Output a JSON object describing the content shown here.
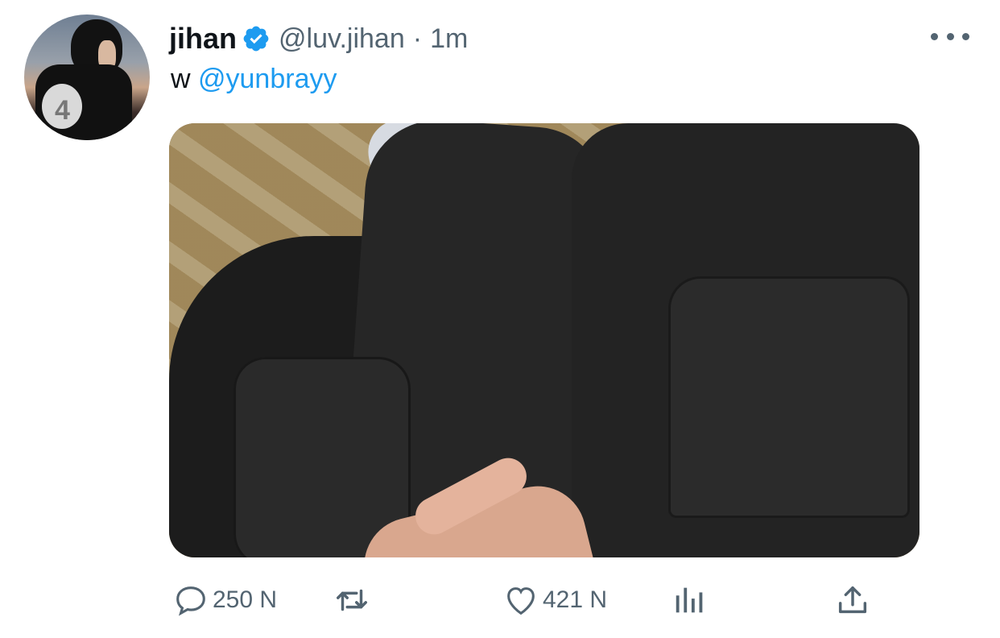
{
  "tweet": {
    "author": {
      "name": "jihan",
      "handle": "@luv.jihan",
      "verified": true,
      "avatar_icon": "profile-photo"
    },
    "separator": "·",
    "time": "1m",
    "text_prefix": "w ",
    "mention": "@yunbrayy",
    "media_description_icon": "photo-black-pants"
  },
  "actions": {
    "reply_count": "250 N",
    "like_count": "421 N"
  },
  "icons": {
    "reply": "speech-bubble-icon",
    "retweet": "retweet-icon",
    "like": "heart-icon",
    "views": "bar-chart-icon",
    "share": "share-upload-icon",
    "more": "more-dots-icon"
  },
  "colors": {
    "accent": "#1d9bf0",
    "muted": "#536471",
    "text": "#0f1419"
  }
}
